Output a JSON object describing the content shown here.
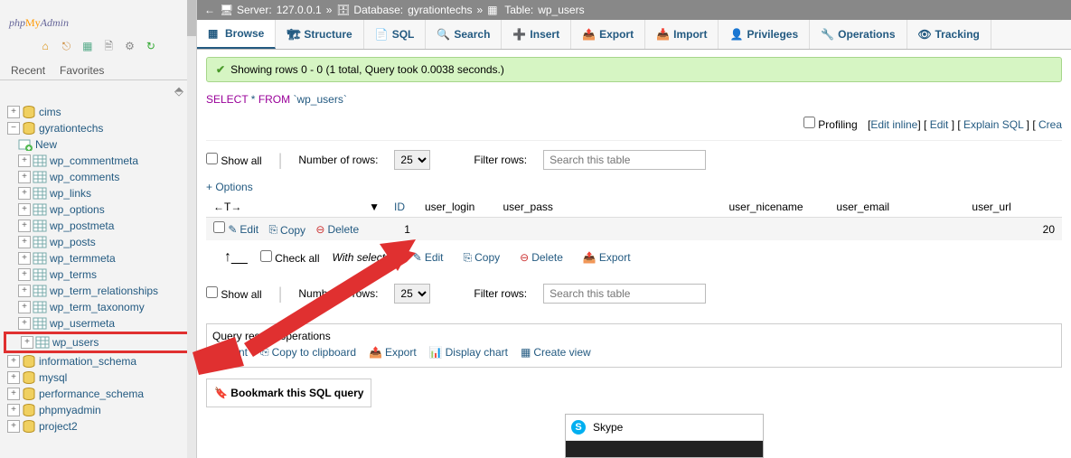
{
  "logo": {
    "php": "php",
    "my": "My",
    "admin": "Admin"
  },
  "sidebar_tabs": {
    "recent": "Recent",
    "favorites": "Favorites"
  },
  "tree": {
    "dbs": [
      {
        "name": "cims",
        "expanded": false
      },
      {
        "name": "gyrationtechs",
        "expanded": true
      },
      {
        "name": "information_schema",
        "expanded": false
      },
      {
        "name": "mysql",
        "expanded": false
      },
      {
        "name": "performance_schema",
        "expanded": false
      },
      {
        "name": "phpmyadmin",
        "expanded": false
      },
      {
        "name": "project2",
        "expanded": false
      }
    ],
    "new_label": "New",
    "tables": [
      "wp_commentmeta",
      "wp_comments",
      "wp_links",
      "wp_options",
      "wp_postmeta",
      "wp_posts",
      "wp_termmeta",
      "wp_terms",
      "wp_term_relationships",
      "wp_term_taxonomy",
      "wp_usermeta",
      "wp_users"
    ]
  },
  "breadcrumb": {
    "server_label": "Server:",
    "server": "127.0.0.1",
    "db_label": "Database:",
    "db": "gyrationtechs",
    "table_label": "Table:",
    "table": "wp_users"
  },
  "tabs": {
    "browse": "Browse",
    "structure": "Structure",
    "sql": "SQL",
    "search": "Search",
    "insert": "Insert",
    "export": "Export",
    "import": "Import",
    "privileges": "Privileges",
    "operations": "Operations",
    "tracking": "Tracking"
  },
  "success": "Showing rows 0 - 0 (1 total, Query took 0.0038 seconds.)",
  "sql": {
    "kw1": "SELECT",
    "rest1": " * ",
    "kw2": "FROM",
    "rest2": " `wp_users`"
  },
  "sql_links": {
    "profiling": "Profiling",
    "edit_inline": "Edit inline",
    "edit": "Edit",
    "explain": "Explain SQL",
    "create": "Crea"
  },
  "controls": {
    "show_all": "Show all",
    "rows_label": "Number of rows:",
    "rows_value": "25",
    "filter_label": "Filter rows:",
    "filter_placeholder": "Search this table"
  },
  "options_link": "+ Options",
  "columns": [
    "ID",
    "user_login",
    "user_pass",
    "user_nicename",
    "user_email",
    "user_url"
  ],
  "row": {
    "edit": "Edit",
    "copy": "Copy",
    "delete": "Delete",
    "id": "1",
    "trailing": "20"
  },
  "bulk": {
    "check_all": "Check all",
    "with_selected": "With selected:",
    "edit": "Edit",
    "copy": "Copy",
    "delete": "Delete",
    "export": "Export"
  },
  "results_ops": {
    "title": "Query results operations",
    "print": "Print",
    "copy_clip": "Copy to clipboard",
    "export": "Export",
    "chart": "Display chart",
    "view": "Create view"
  },
  "bookmark": "Bookmark this SQL query",
  "skype": "Skype"
}
